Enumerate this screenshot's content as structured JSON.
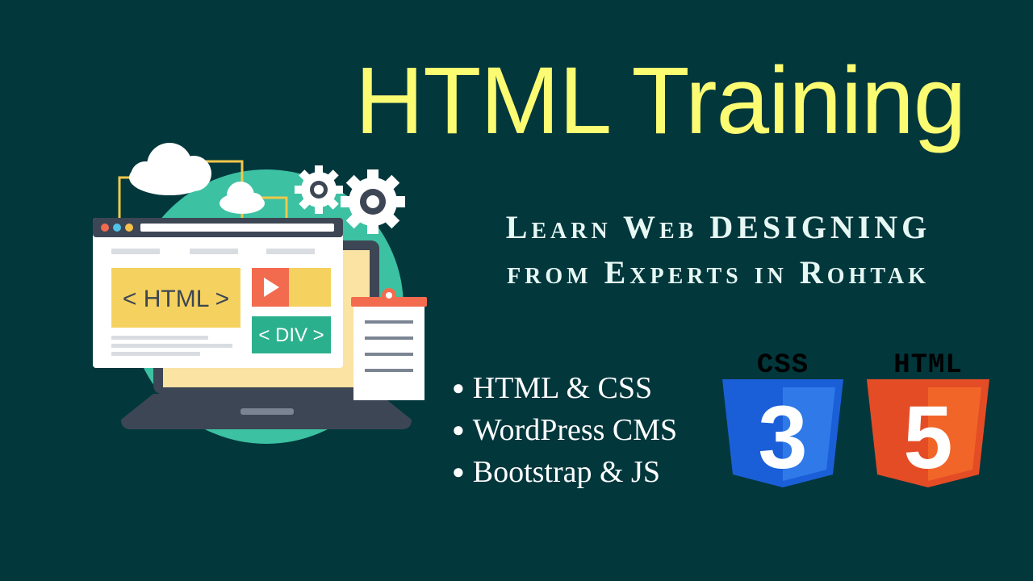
{
  "heading": "HTML Training",
  "tagline": {
    "line1": "Learn Web DESIGNING",
    "line2": "from Experts in Rohtak"
  },
  "courses": [
    "HTML & CSS",
    "WordPress CMS",
    "Bootstrap & JS"
  ],
  "illustration": {
    "html_tag": "< HTML >",
    "div_tag": "< DIV >"
  },
  "logos": {
    "css": {
      "label": "CSS",
      "number": "3",
      "color": "#1b5fd8"
    },
    "html": {
      "label": "HTML",
      "number": "5",
      "color": "#e44c26"
    }
  },
  "colors": {
    "background": "#02373c",
    "title": "#fcfc72",
    "accent_teal": "#3cc1a2"
  }
}
